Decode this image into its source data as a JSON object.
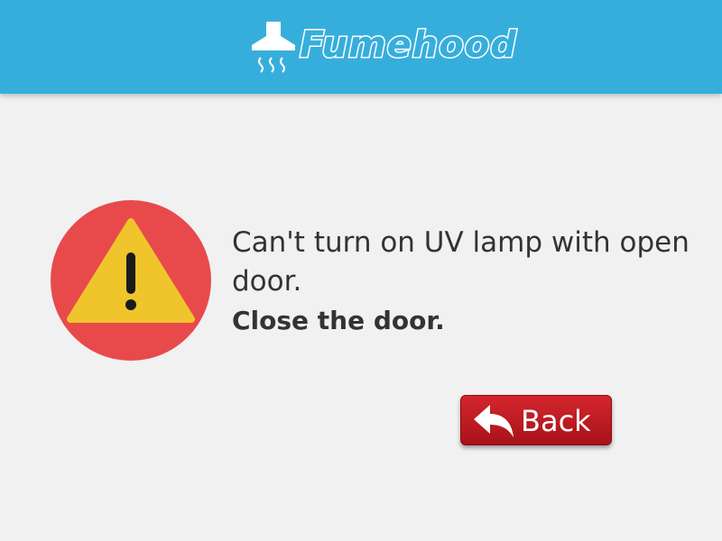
{
  "header": {
    "brand_name": "Fumehood",
    "background_color": "#36aedc",
    "logo_icon": "fume-hood-icon"
  },
  "alert": {
    "icon": "warning-icon",
    "icon_circle_color": "#e84a4b",
    "icon_triangle_color": "#f0c52c",
    "message": "Can't turn on UV lamp with open door.",
    "instruction": "Close the door."
  },
  "actions": {
    "back_label": "Back",
    "back_icon": "reply-arrow-icon",
    "back_color": "#c81c24"
  }
}
